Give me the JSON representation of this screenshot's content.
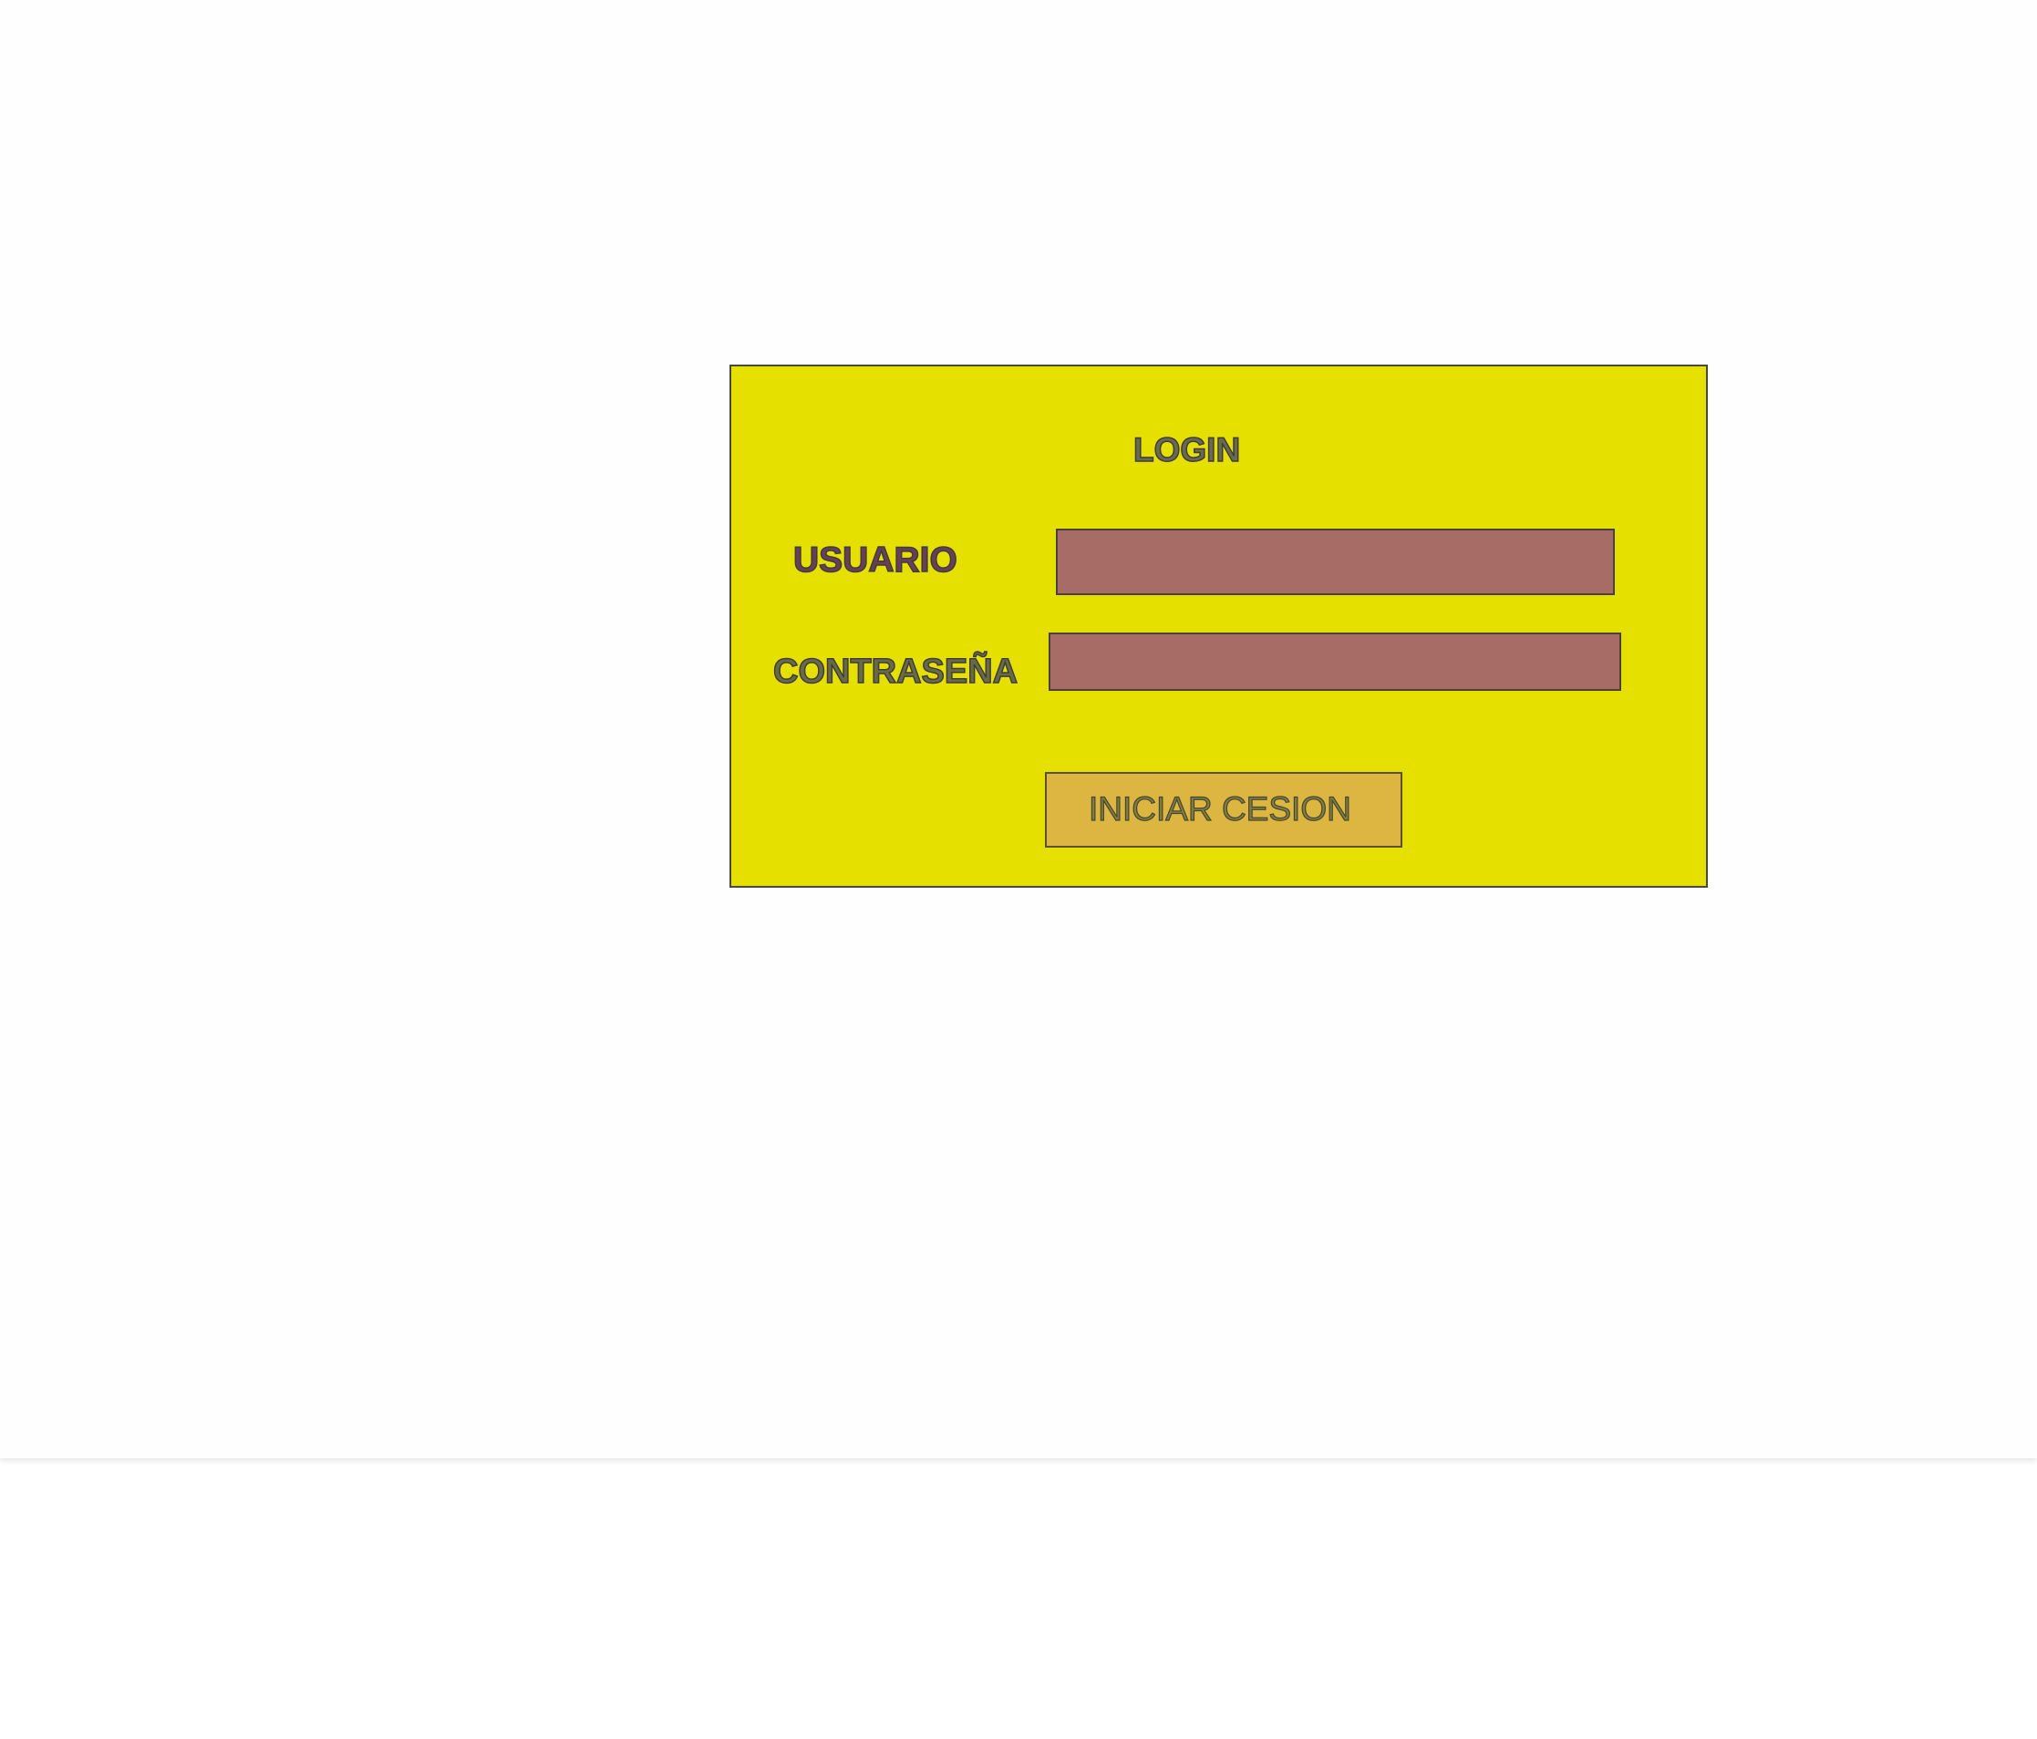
{
  "login_panel": {
    "title": "LOGIN",
    "username_label": "USUARIO",
    "username_value": "",
    "password_label": "CONTRASEÑA",
    "password_value": "",
    "submit_label": "INICIAR CESION"
  },
  "colors": {
    "panel_background": "#e6e000",
    "input_background": "#a86c66",
    "button_background": "#ddb642",
    "page_background": "#fefefe"
  }
}
